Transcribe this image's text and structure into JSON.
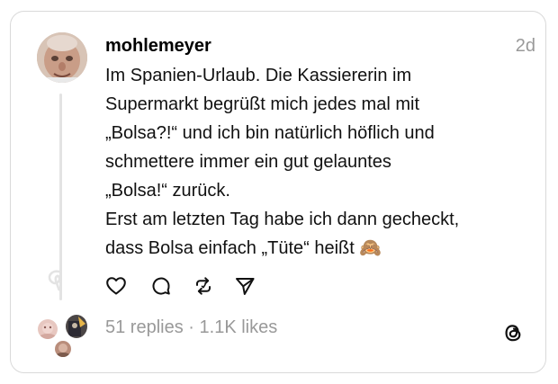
{
  "post": {
    "username": "mohlemeyer",
    "time": "2d",
    "lines": [
      "Im Spanien-Urlaub. Die Kassiererin im",
      "Supermarkt begrüßt mich jedes mal mit",
      "„Bolsa?!“ und ich bin natürlich höflich und",
      "schmettere immer ein gut gelauntes",
      "„Bolsa!“ zurück.",
      "Erst am letzten Tag habe ich dann gecheckt,",
      "dass Bolsa einfach „Tüte“ heißt 🙈"
    ]
  },
  "stats": {
    "replies": "51 replies",
    "separator": "·",
    "likes": "1.1K likes"
  },
  "icons": {
    "like": "heart-icon",
    "reply": "comment-icon",
    "repost": "repost-icon",
    "share": "send-icon",
    "brand": "threads-logo-icon"
  },
  "colors": {
    "text": "#111111",
    "muted": "#999999",
    "border": "#d9d9d9",
    "thread_line": "#e3e3e3"
  }
}
